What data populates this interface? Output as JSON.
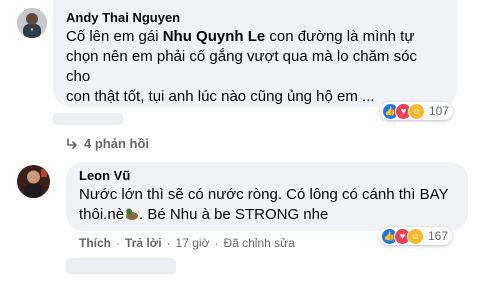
{
  "comment1": {
    "author": "Andy Thai Nguyen",
    "text_before": "Cố lên em gái ",
    "mention": "Nhu Quynh Le",
    "text_after": " con đường là mình tự",
    "line2": "chọn nên em phải cố gắng vượt qua mà lo chăm sóc",
    "line3": "cho",
    "line4": "con thật tốt, tụi anh lúc nào cũng ủng hộ em ...",
    "reaction_count": "107"
  },
  "replies_link": {
    "icon": "reply-arrow-icon",
    "label": "4 phản hồi"
  },
  "comment2": {
    "author": "Leon Vũ",
    "line1": "Nước lớn thì sẽ có nước ròng. Có lông có cánh thì BAY",
    "line2_before": "thôi.nè",
    "line2_after": ". Bé Nhu à be STRONG nhe",
    "emoji": "duck-emoji",
    "reaction_count": "167",
    "actions": {
      "like": "Thích",
      "reply": "Trả lời",
      "time": "17 giờ",
      "edited": "Đã chỉnh sửa"
    }
  },
  "colors": {
    "bubble": "#f0f2f5",
    "like_blue": "#1877f2",
    "love_red": "#f33e58",
    "haha_yellow": "#f7b928",
    "meta_gray": "#65676b"
  }
}
